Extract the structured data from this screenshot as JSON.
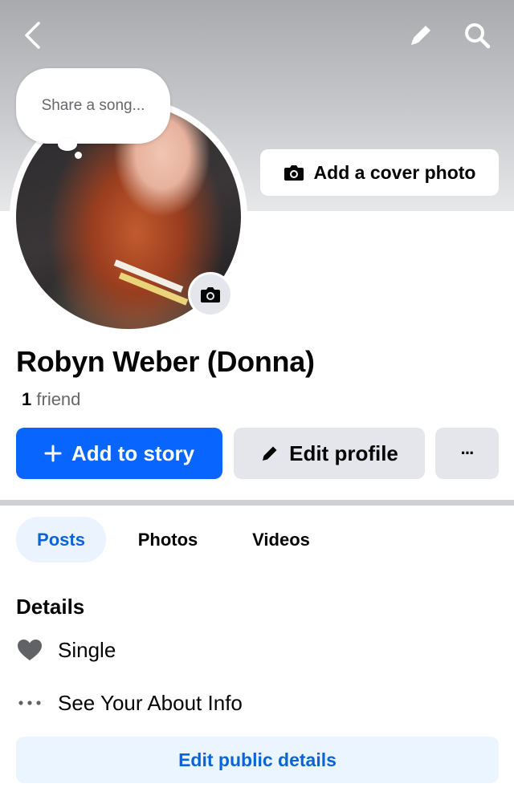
{
  "header": {
    "back_icon": "chevron-left-icon",
    "edit_icon": "pencil-icon",
    "search_icon": "search-icon"
  },
  "cover": {
    "add_cover_label": "Add a cover photo",
    "camera_icon": "camera-icon"
  },
  "note_bubble": {
    "placeholder": "Share a song..."
  },
  "profile": {
    "name": "Robyn Weber (Donna)",
    "friend_count": "1",
    "friend_label": "friend"
  },
  "actions": {
    "add_story_label": "Add to story",
    "edit_profile_label": "Edit profile",
    "more_label": "···"
  },
  "tabs": [
    {
      "label": "Posts",
      "active": true
    },
    {
      "label": "Photos",
      "active": false
    },
    {
      "label": "Videos",
      "active": false
    }
  ],
  "details": {
    "title": "Details",
    "items": [
      {
        "icon": "heart-icon",
        "label": "Single"
      },
      {
        "icon": "more-dots-icon",
        "label": "See Your About Info"
      }
    ],
    "edit_button_label": "Edit public details"
  },
  "colors": {
    "primary_blue": "#0866ff",
    "link_blue": "#0a64d8",
    "secondary_button": "#e4e6eb",
    "muted_text": "#65676b"
  }
}
